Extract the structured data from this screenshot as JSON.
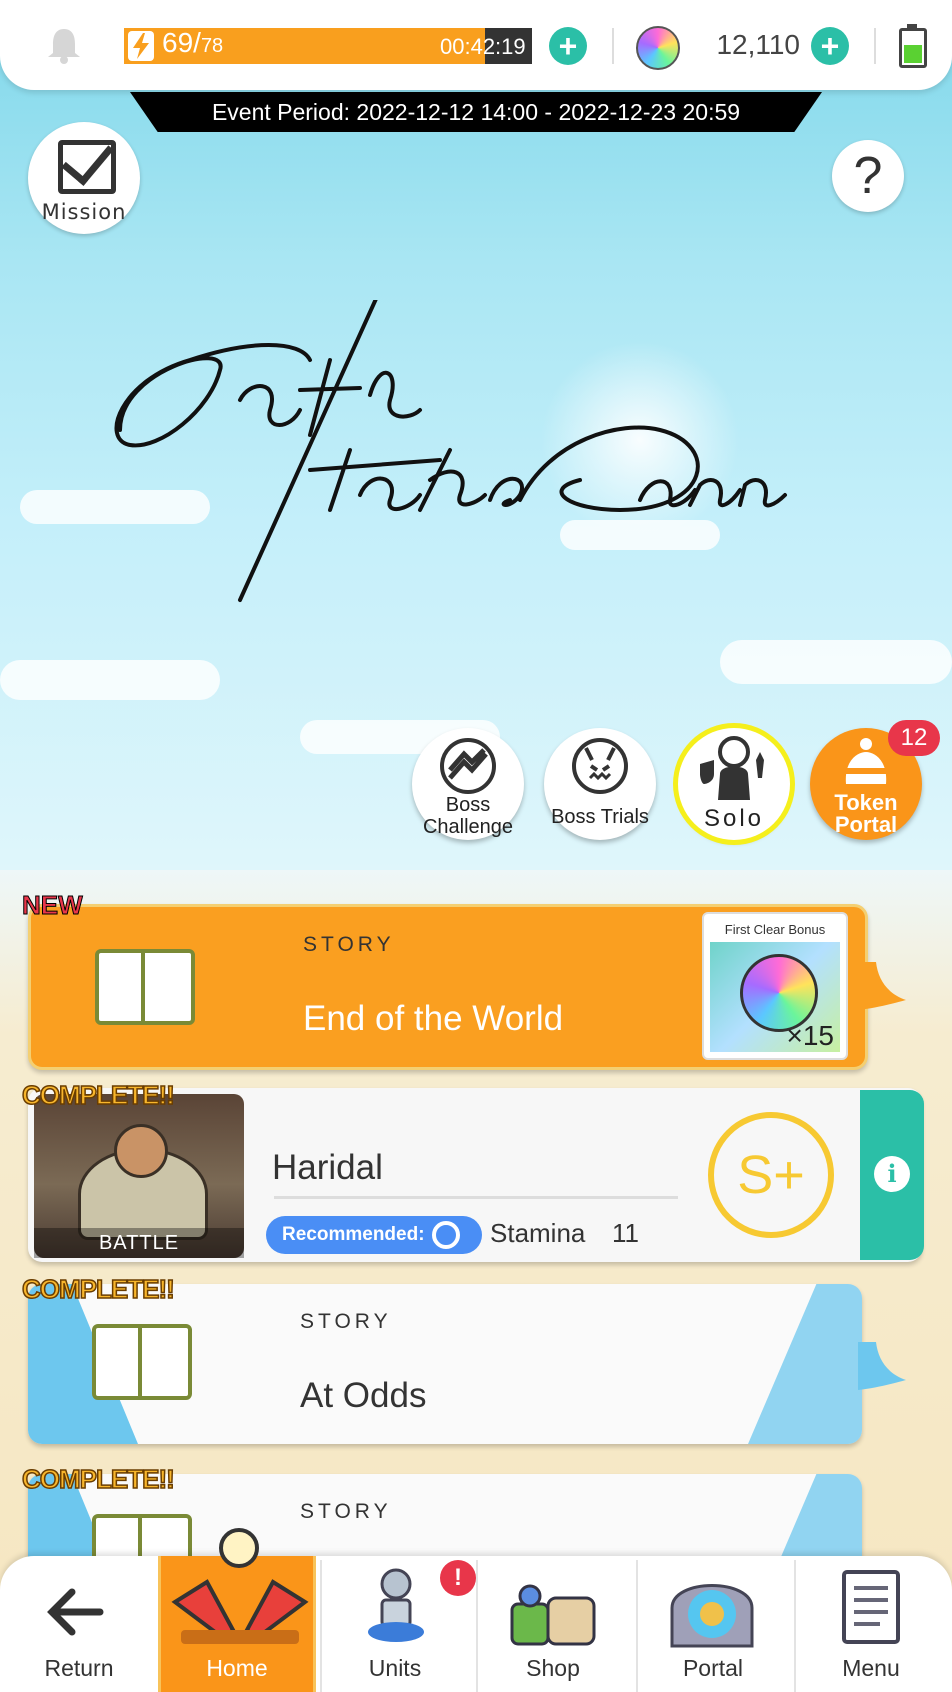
{
  "top_bar": {
    "stamina_current": "69",
    "stamina_max": "78",
    "stamina_fraction": 0.885,
    "timer": "00:42:19",
    "gems": "12,110",
    "battery_level": "full",
    "icons": [
      "bell-icon",
      "bolt-icon",
      "gem-icon",
      "battery-icon",
      "plus-icon"
    ]
  },
  "event_period": "Event Period: 2022-12-12 14:00 - 2022-12-23 20:59",
  "mission_label": "Mission",
  "help_label": "?",
  "event_buttons": {
    "boss_challenge_line1": "Boss",
    "boss_challenge_line2": "Challenge",
    "boss_trials": "Boss Trials",
    "solo": "Solo",
    "token_portal_line1": "Token",
    "token_portal_line2": "Portal",
    "token_badge": "12"
  },
  "cards": [
    {
      "tag": "NEW",
      "kind": "STORY",
      "title": "End of the World",
      "bonus_label": "First Clear Bonus",
      "bonus_count": "×15"
    },
    {
      "tag": "COMPLETE!!",
      "image_label": "BATTLE",
      "title": "Haridal",
      "recommended_label": "Recommended:",
      "stamina_label": "Stamina",
      "stamina_value": "11",
      "rank": "S+"
    },
    {
      "tag": "COMPLETE!!",
      "kind": "STORY",
      "title": "At Odds"
    },
    {
      "tag": "COMPLETE!!",
      "kind": "STORY"
    }
  ],
  "nav": {
    "return": "Return",
    "home": "Home",
    "units": "Units",
    "units_alert": "!",
    "shop": "Shop",
    "portal": "Portal",
    "menu": "Menu"
  },
  "colors": {
    "accent_orange": "#fa9f20",
    "teal": "#2bbfa7",
    "alert_red": "#e8364a",
    "recommended_blue": "#4a8ef5"
  }
}
